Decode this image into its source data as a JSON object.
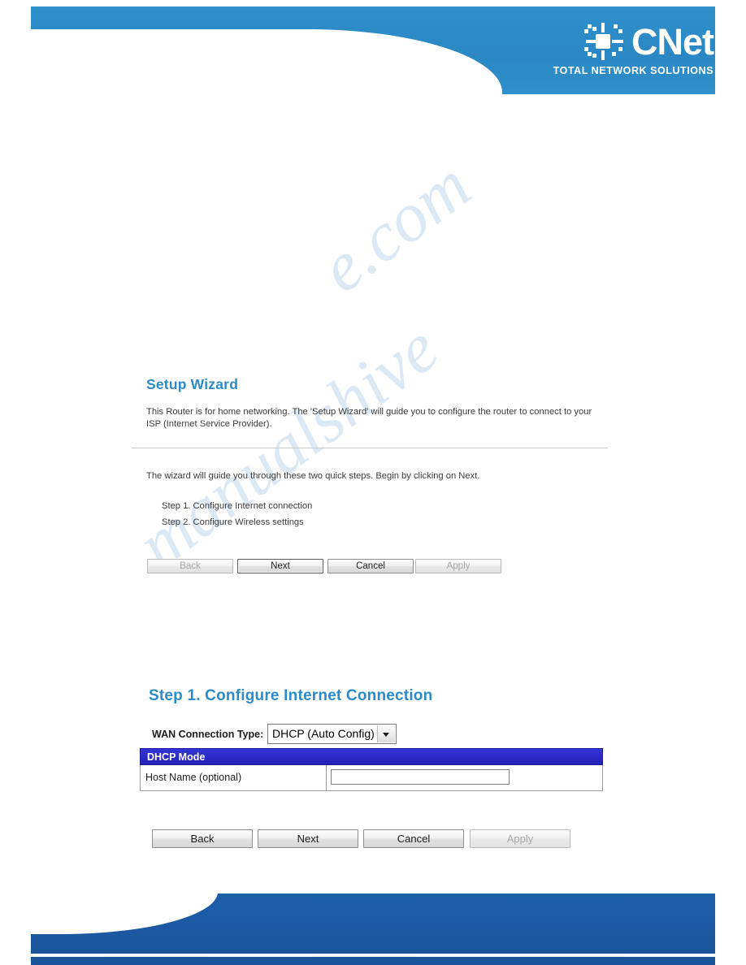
{
  "header": {
    "logo_text": "CNet",
    "logo_mark": "cnet-logo-mark",
    "tagline": "TOTAL NETWORK SOLUTIONS"
  },
  "watermark": {
    "line1": "e.com",
    "line2": "manualshive"
  },
  "wizard": {
    "title": "Setup Wizard",
    "intro": "This Router is for home networking. The 'Setup Wizard' will guide you to configure the router to connect to your ISP (Internet Service Provider).",
    "lead": "The wizard will guide you through these two quick steps. Begin by clicking on Next.",
    "steps": [
      "Step 1. Configure Internet connection",
      "Step 2. Configure Wireless settings"
    ],
    "buttons": {
      "back": "Back",
      "next": "Next",
      "cancel": "Cancel",
      "apply": "Apply"
    }
  },
  "step1": {
    "title": "Step 1. Configure Internet Connection",
    "wan_label": "WAN Connection Type:",
    "wan_value": "DHCP (Auto Config)",
    "table": {
      "header": "DHCP Mode",
      "row_label": "Host Name (optional)",
      "row_value": "",
      "row_placeholder": ""
    },
    "buttons": {
      "back": "Back",
      "next": "Next",
      "cancel": "Cancel",
      "apply": "Apply"
    }
  }
}
